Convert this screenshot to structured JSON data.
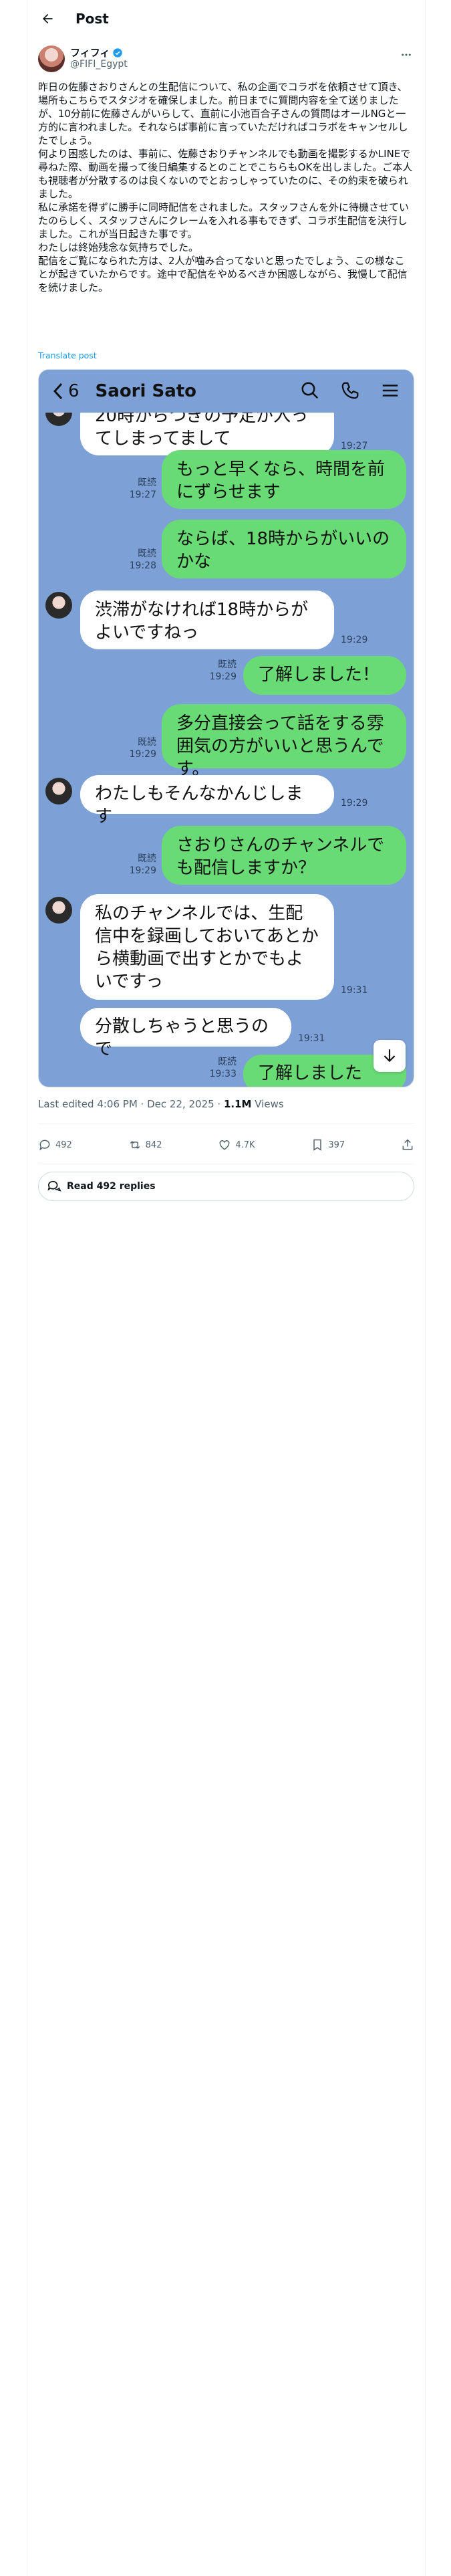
{
  "topbar": {
    "title": "Post"
  },
  "author": {
    "name": "フィフィ",
    "handle": "@FIFI_Egypt"
  },
  "tweet": {
    "text": "昨日の佐藤さおりさんとの生配信について、私の企画でコラボを依頼させて頂き、場所もこちらでスタジオを確保しました。前日までに質問内容を全て送りましたが、10分前に佐藤さんがいらして、直前に小池百合子さんの質問はオールNGと一方的に言われました。それならば事前に言っていただければコラボをキャンセルしたでしょう。\n何より困惑したのは、事前に、佐藤さおりチャンネルでも動画を撮影するかLINEで尋ねた際、動画を撮って後日編集するとのことでこちらもOKを出しました。ご本人も視聴者が分散するのは良くないのでとおっしゃっていたのに、その約束を破られました。\n私に承諾を得ずに勝手に同時配信をされました。スタッフさんを外に待機させていたのらしく、スタッフさんにクレームを入れる事もできず、コラボ生配信を決行しました。これが当日起きた事です。\nわたしは終始残念な気持ちでした。\n配信をご覧になられた方は、2人が噛み合ってないと思ったでしょう、この様なことが起きていたからです。途中で配信をやめるべきか困惑しながら、我慢して配信を続けました。",
    "translate_label": "Translate post",
    "edited_prefix": "Last edited 4:06 PM · Dec 22, 2025 · ",
    "views_count": "1.1M",
    "views_label": " Views"
  },
  "chat": {
    "back_count": "6",
    "contact_name": "Saori Sato",
    "read_label": "既読",
    "messages": [
      {
        "side": "left",
        "text": "20時からつぎの予定が入ってしまってまして",
        "time": "19:27"
      },
      {
        "side": "right",
        "text": "もっと早くなら、時間を前にずらせます",
        "time": "19:27"
      },
      {
        "side": "right",
        "text": "ならば、18時からがいいのかな",
        "time": "19:28"
      },
      {
        "side": "left",
        "text": "渋滞がなければ18時からがよいですねっ",
        "time": "19:29"
      },
      {
        "side": "right",
        "text": "了解しました！",
        "time": "19:29"
      },
      {
        "side": "right",
        "text": "多分直接会って話をする雰囲気の方がいいと思うんです。",
        "time": "19:29"
      },
      {
        "side": "left",
        "text": "わたしもそんなかんじします",
        "time": "19:29"
      },
      {
        "side": "right",
        "text": "さおりさんのチャンネルでも配信しますか？",
        "time": "19:29"
      },
      {
        "side": "left",
        "text": "私のチャンネルでは、生配信中を録画しておいてあとから横動画で出すとかでもよいですっ",
        "time": "19:31"
      },
      {
        "side": "left",
        "text": "分散しちゃうと思うので",
        "time": "19:31"
      },
      {
        "side": "right",
        "text": "了解しました",
        "time": "19:33"
      }
    ]
  },
  "actions": {
    "replies": "492",
    "reposts": "842",
    "likes": "4.7K",
    "bookmarks": "397"
  },
  "read_replies": {
    "label": "Read 492 replies"
  }
}
